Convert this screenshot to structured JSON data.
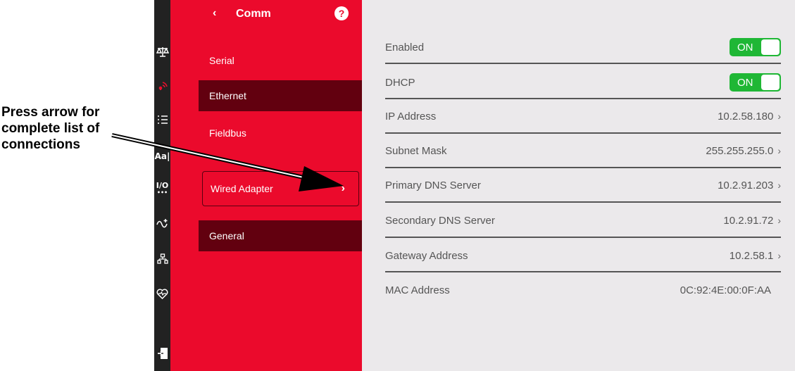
{
  "callout": {
    "line1": "Press arrow for",
    "line2": "complete list of",
    "line3": "connections"
  },
  "rail": {
    "icons": [
      "scale-icon",
      "wireless-icon",
      "list-icon",
      "text-size-icon",
      "io-icon",
      "signal-icon",
      "network-icon",
      "heart-icon",
      "logout-icon"
    ]
  },
  "nav": {
    "back": "‹",
    "title": "Comm",
    "help": "?",
    "items": [
      {
        "label": "Serial"
      },
      {
        "label": "Ethernet"
      },
      {
        "label": "Fieldbus"
      },
      {
        "label": "Wired Adapter",
        "chevron": "›"
      },
      {
        "label": "General"
      }
    ]
  },
  "settings": {
    "enabled": {
      "label": "Enabled",
      "toggle": "ON"
    },
    "dhcp": {
      "label": "DHCP",
      "toggle": "ON"
    },
    "ip": {
      "label": "IP Address",
      "value": "10.2.58.180",
      "chevron": "›"
    },
    "subnet": {
      "label": "Subnet Mask",
      "value": "255.255.255.0",
      "chevron": "›"
    },
    "dns1": {
      "label": "Primary DNS Server",
      "value": "10.2.91.203",
      "chevron": "›"
    },
    "dns2": {
      "label": "Secondary DNS Server",
      "value": "10.2.91.72",
      "chevron": "›"
    },
    "gateway": {
      "label": "Gateway Address",
      "value": "10.2.58.1",
      "chevron": "›"
    },
    "mac": {
      "label": "MAC Address",
      "value": "0C:92:4E:00:0F:AA"
    }
  },
  "colors": {
    "accent": "#eb0a2c",
    "nav_selected": "#62000f",
    "toggle_on": "#1fb735",
    "rail": "#222222",
    "content_bg": "#ebe9eb"
  }
}
